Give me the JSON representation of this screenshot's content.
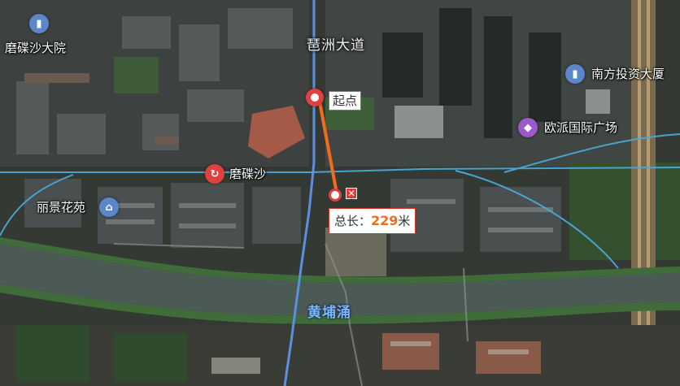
{
  "map": {
    "view": "satellite",
    "pois": [
      {
        "id": "modiesha-dayuan",
        "label": "磨碟沙大院",
        "icon": "building-icon",
        "color": "#5b86c9"
      },
      {
        "id": "nanfang-touzi",
        "label": "南方投资大厦",
        "icon": "building-icon",
        "color": "#5b86c9"
      },
      {
        "id": "oupai",
        "label": "欧派国际广场",
        "icon": "shopping-bag-icon",
        "color": "#9b59c9"
      },
      {
        "id": "lijing",
        "label": "丽景花苑",
        "icon": "house-icon",
        "color": "#5b86c9"
      },
      {
        "id": "modiesha-station",
        "label": "磨碟沙",
        "icon": "metro-station-icon",
        "color": "#e0413f"
      }
    ],
    "roads": [
      {
        "id": "pazhou-dadao",
        "label": "琶洲大道"
      }
    ],
    "water": [
      {
        "id": "huangpu-chong",
        "label": "黄埔涌",
        "color": "#7ab7ff"
      }
    ]
  },
  "measure": {
    "start_label": "起点",
    "total_prefix": "总长：",
    "total_value": "229",
    "total_unit": "米",
    "line_color": "#f26b1d",
    "close_glyph": "✕"
  }
}
